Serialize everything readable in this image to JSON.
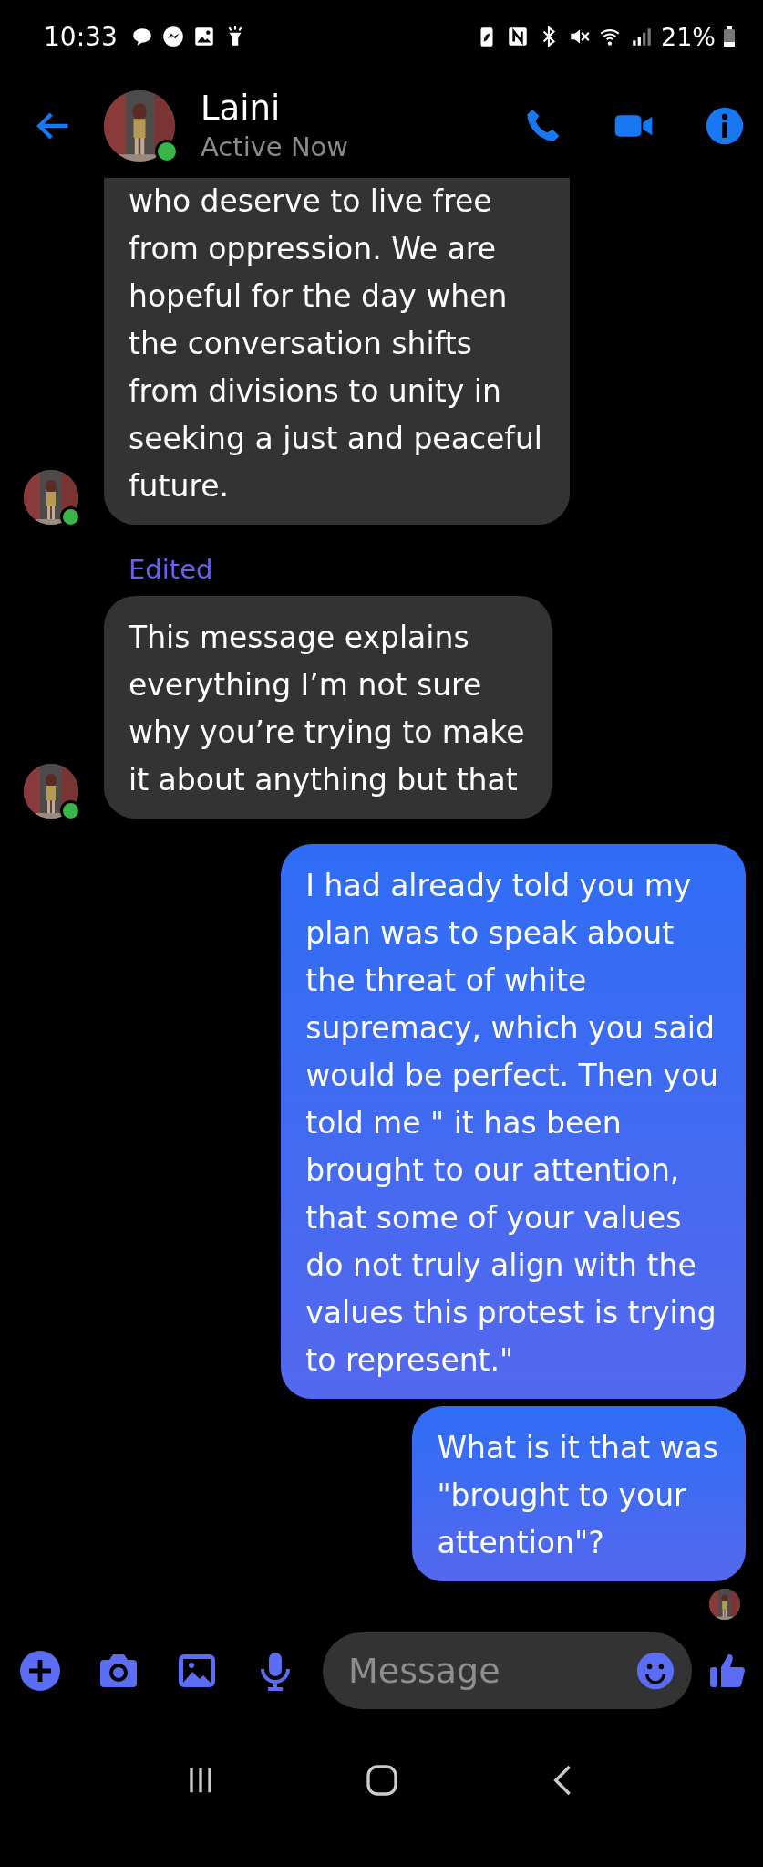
{
  "status_bar": {
    "time": "10:33",
    "battery": "21%"
  },
  "header": {
    "name": "Laini",
    "status": "Active Now",
    "online": true
  },
  "messages": [
    {
      "kind": "received",
      "edited": false,
      "show_avatar": true,
      "lines": [
        "who deserve to live free",
        "from oppression. We are",
        "hopeful for the day when",
        "the conversation shifts",
        "from divisions to unity in",
        "seeking a just and peaceful",
        "future."
      ]
    },
    {
      "kind": "received",
      "edited": true,
      "edited_label": "Edited",
      "show_avatar": true,
      "lines": [
        "This message explains",
        "everything I’m not sure",
        "why you’re trying to make",
        "it about anything but that"
      ]
    },
    {
      "kind": "sent",
      "lines": [
        "I had already told you my",
        "plan was to speak about",
        "the threat of white",
        "supremacy, which you said",
        "would be perfect. Then you",
        "told me \" it has been",
        "brought to our attention,",
        "that some of your values",
        "do not truly align with the",
        "values this protest is trying",
        "to represent.\""
      ]
    },
    {
      "kind": "sent",
      "lines": [
        "What is it that was",
        "\"brought to your",
        "attention\"?"
      ]
    }
  ],
  "read_receipt": true,
  "composer": {
    "placeholder": "Message"
  }
}
